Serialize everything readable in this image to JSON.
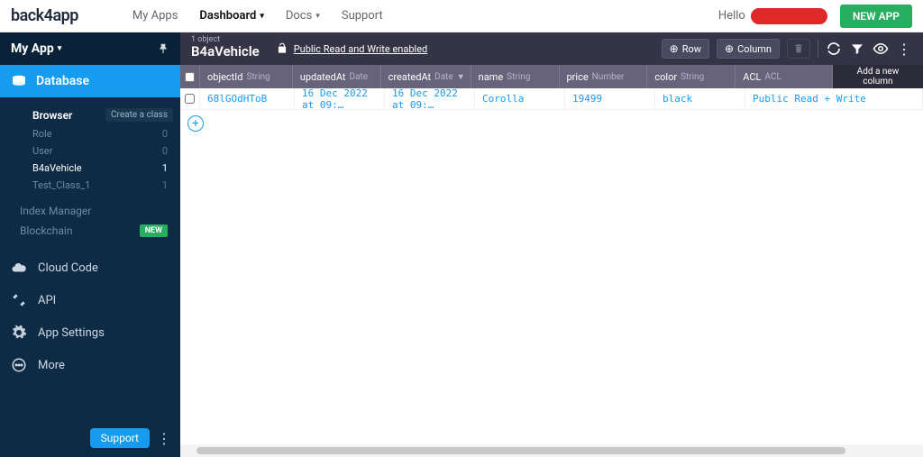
{
  "topnav": {
    "logo": "back4app",
    "items": [
      "My Apps",
      "Dashboard",
      "Docs",
      "Support"
    ],
    "hello": "Hello",
    "newapp": "NEW APP"
  },
  "sidebar": {
    "app_name": "My App",
    "database": "Database",
    "browser_label": "Browser",
    "create_class": "Create a class",
    "classes": [
      {
        "name": "Role",
        "count": "0"
      },
      {
        "name": "User",
        "count": "0"
      },
      {
        "name": "B4aVehicle",
        "count": "1"
      },
      {
        "name": "Test_Class_1",
        "count": "1"
      }
    ],
    "index_manager": "Index Manager",
    "blockchain": "Blockchain",
    "new_badge": "NEW",
    "menu": [
      "Cloud Code",
      "API",
      "App Settings",
      "More"
    ],
    "support": "Support"
  },
  "table": {
    "object_count": "1 object",
    "class_title": "B4aVehicle",
    "security": "Public Read and Write enabled",
    "row_btn": "Row",
    "col_btn": "Column",
    "add_col": "Add a new column",
    "columns": [
      {
        "name": "objectId",
        "type": "String"
      },
      {
        "name": "updatedAt",
        "type": "Date"
      },
      {
        "name": "createdAt",
        "type": "Date"
      },
      {
        "name": "name",
        "type": "String"
      },
      {
        "name": "price",
        "type": "Number"
      },
      {
        "name": "color",
        "type": "String"
      },
      {
        "name": "ACL",
        "type": "ACL"
      }
    ],
    "row": {
      "objectId": "68lGOdHToB",
      "updatedAt": "16 Dec 2022 at 09:…",
      "createdAt": "16 Dec 2022 at 09:…",
      "name": "Corolla",
      "price": "19499",
      "color": "black",
      "acl": "Public Read + Write"
    }
  }
}
